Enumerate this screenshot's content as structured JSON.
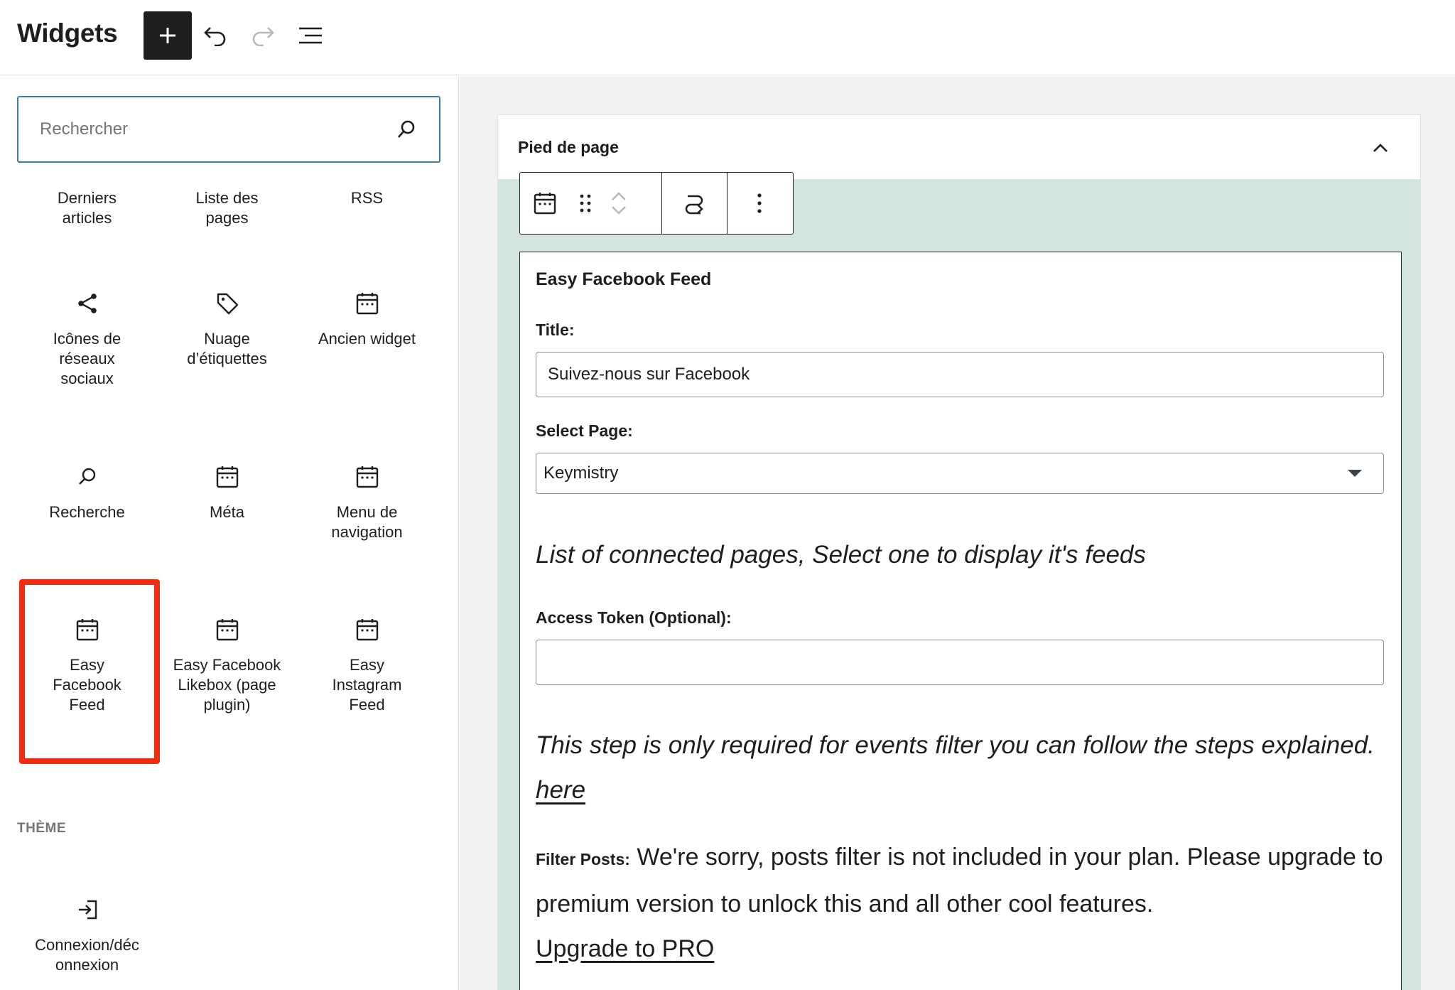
{
  "header": {
    "title": "Widgets",
    "add_icon": "plus-icon",
    "undo_icon": "undo-icon",
    "redo_icon": "redo-icon",
    "list_icon": "list-view-icon"
  },
  "sidebar": {
    "search": {
      "placeholder": "Rechercher",
      "value": ""
    },
    "blocks": [
      {
        "label": "Derniers articles",
        "icon": "none"
      },
      {
        "label": "Liste des pages",
        "icon": "none"
      },
      {
        "label": "RSS",
        "icon": "none"
      },
      {
        "label": "Icônes de réseaux sociaux",
        "icon": "share-icon"
      },
      {
        "label": "Nuage d’étiquettes",
        "icon": "tag-icon"
      },
      {
        "label": "Ancien widget",
        "icon": "calendar-icon"
      },
      {
        "label": "Recherche",
        "icon": "search-icon"
      },
      {
        "label": "Méta",
        "icon": "calendar-icon"
      },
      {
        "label": "Menu de navigation",
        "icon": "calendar-icon"
      },
      {
        "label": "Easy Facebook Feed",
        "icon": "calendar-icon"
      },
      {
        "label": "Easy Facebook Likebox (page plugin)",
        "icon": "calendar-icon"
      },
      {
        "label": "Easy Instagram Feed",
        "icon": "calendar-icon"
      },
      {
        "label": "Connexion/déconnexion",
        "icon": "login-icon"
      }
    ],
    "theme_section": "THÈME",
    "highlight_color": "#f22c12"
  },
  "main": {
    "area_title": "Pied de page",
    "widget": {
      "title": "Easy Facebook Feed",
      "title_label": "Title:",
      "title_value": "Suivez-nous sur Facebook",
      "page_label": "Select Page:",
      "page_value": "Keymistry",
      "pages_note": "List of connected pages, Select one to display it's feeds",
      "token_label": "Access Token (Optional):",
      "token_value": "",
      "token_note": "This step is only required for events filter you can follow the steps explained.",
      "token_note_link": "here",
      "filter_label": "Filter Posts:",
      "filter_text": "We're sorry, posts filter is not included in your plan. Please upgrade to premium version to unlock this and all other cool features.",
      "upgrade_link": "Upgrade to PRO"
    },
    "canvas_bg": "#f0f0f0",
    "area_bg": "#d5e6e0"
  }
}
